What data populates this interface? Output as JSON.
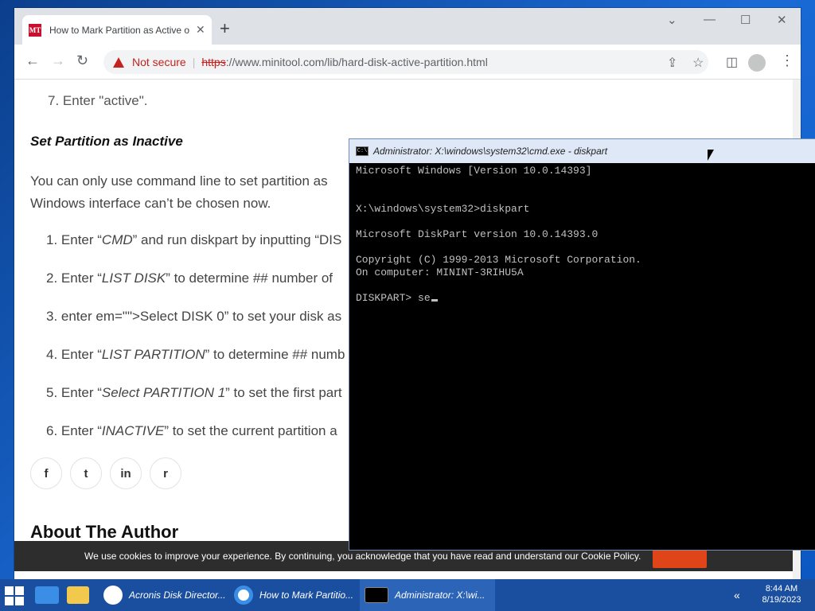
{
  "browser": {
    "tab_title": "How to Mark Partition as Active o",
    "tab_close": "✕",
    "new_tab": "+",
    "not_secure": "Not secure",
    "url_https": "https",
    "url_rest": "://www.minitool.com/lib/hard-disk-active-partition.html",
    "favicon_text": "MT"
  },
  "article": {
    "cut_line": "7. Enter \"active\".",
    "heading": "Set Partition as Inactive",
    "paragraph_1": "You can only use command line to set partition as",
    "paragraph_2": "Windows interface can’t be chosen now.",
    "steps": [
      {
        "prefix": "1. Enter “",
        "italic": "CMD",
        "suffix": "” and run diskpart by inputting “DIS"
      },
      {
        "prefix": "2. Enter “",
        "italic": "LIST DISK",
        "suffix": "” to determine ## number of"
      },
      {
        "prefix": "3. enter em=\"\">Select DISK 0” to set your disk as",
        "italic": "",
        "suffix": ""
      },
      {
        "prefix": "4. Enter “",
        "italic": "LIST PARTITION",
        "suffix": "” to determine ## numb"
      },
      {
        "prefix": "5. Enter “",
        "italic": "Select PARTITION 1",
        "suffix": "” to set the first part"
      },
      {
        "prefix": "6. Enter “",
        "italic": "INACTIVE",
        "suffix": "” to set the current partition a"
      }
    ],
    "social": [
      "f",
      "t",
      "in",
      "r"
    ],
    "author_heading": "About The Author",
    "cookie_text": "We use cookies to improve your experience. By continuing, you acknowledge that you have read and understand our Cookie Policy."
  },
  "cmd": {
    "icon_text": "C:\\",
    "title": "Administrator: X:\\windows\\system32\\cmd.exe - diskpart",
    "lines": [
      "Microsoft Windows [Version 10.0.14393]",
      "",
      "X:\\windows\\system32>diskpart",
      "",
      "Microsoft DiskPart version 10.0.14393.0",
      "",
      "Copyright (C) 1999-2013 Microsoft Corporation.",
      "On computer: MININT-3RIHU5A",
      "",
      "DISKPART> se"
    ]
  },
  "taskbar": {
    "acronis": "Acronis Disk Director...",
    "chrome": "How to Mark Partitio...",
    "cmd": "Administrator: X:\\wi...",
    "time": "8:44 AM",
    "date": "8/19/2023",
    "chevron": "«"
  },
  "colors": {
    "accent_red": "#c5221f",
    "taskbar": "#1a4fa0",
    "cmd_bg": "#000000",
    "cmd_text": "#c0c0c0"
  }
}
